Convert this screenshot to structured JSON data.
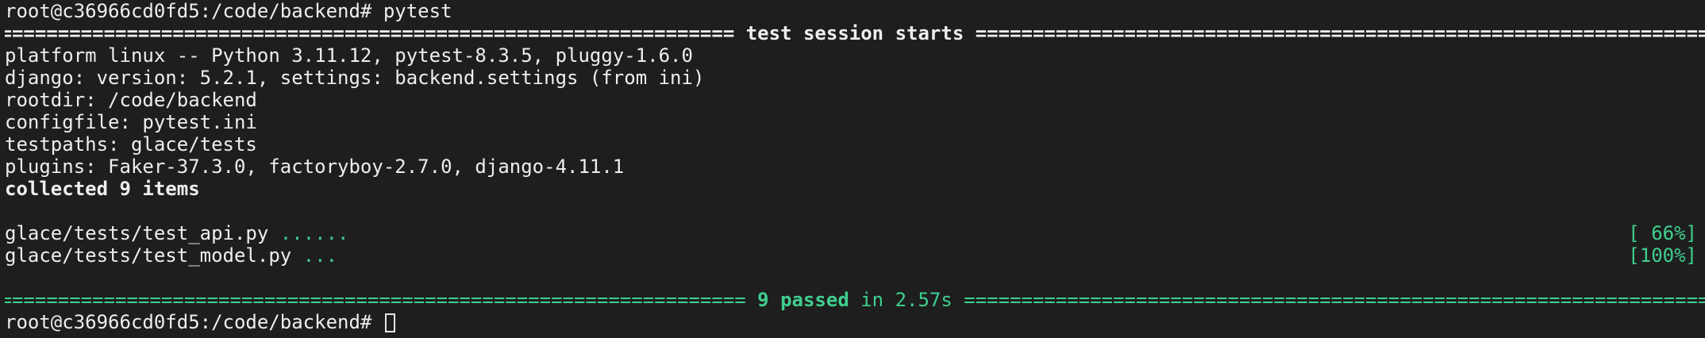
{
  "terminal": {
    "prompt": "root@c36966cd0fd5:/code/backend#",
    "command": "pytest",
    "session_title": " test session starts ",
    "info_lines": [
      "platform linux -- Python 3.11.12, pytest-8.3.5, pluggy-1.6.0",
      "django: version: 5.2.1, settings: backend.settings (from ini)",
      "rootdir: /code/backend",
      "configfile: pytest.ini",
      "testpaths: glace/tests",
      "plugins: Faker-37.3.0, factoryboy-2.7.0, django-4.11.1"
    ],
    "collected": "collected 9 items",
    "results": [
      {
        "file": "glace/tests/test_api.py",
        "dots": "......",
        "percent": "[ 66%]"
      },
      {
        "file": "glace/tests/test_model.py",
        "dots": "...",
        "percent": "[100%]"
      }
    ],
    "summary_passed": "9 passed",
    "summary_time": "in 2.57s",
    "rule_fill": "=================================================================================================================================================================================================",
    "colors": {
      "background": "#1e1e1e",
      "text": "#eeeeee",
      "pass_green": "#3fcf8e"
    }
  }
}
